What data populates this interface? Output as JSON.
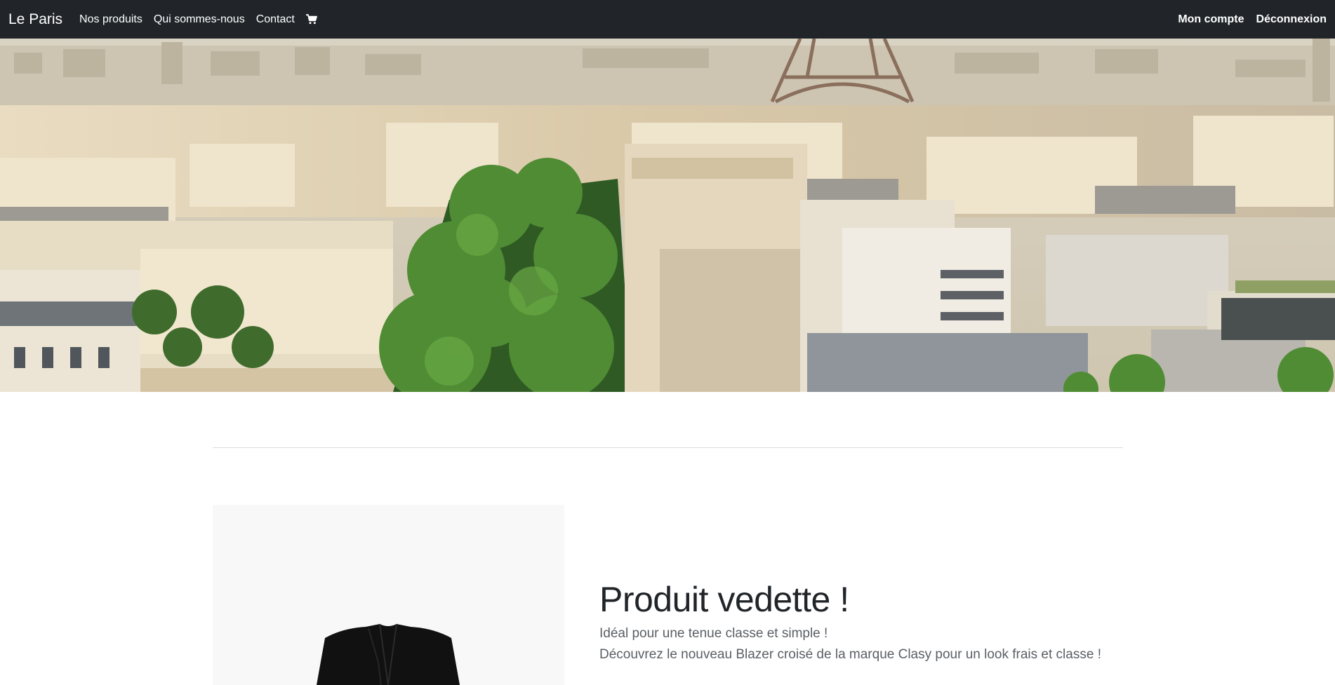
{
  "navbar": {
    "brand": "Le Paris",
    "links": [
      "Nos produits",
      "Qui sommes-nous",
      "Contact"
    ],
    "cart_icon": "cart-icon",
    "right_links": [
      "Mon compte",
      "Déconnexion"
    ]
  },
  "hero": {
    "image": "paris-cityscape-eiffel-tower"
  },
  "featured": {
    "title": "Produit vedette !",
    "line1": "Idéal pour une tenue classe et simple !",
    "line2": "Découvrez le nouveau Blazer croisé de la marque Clasy pour un look frais et classe !",
    "image": "black-blazer"
  },
  "colors": {
    "navbar_bg": "#212529",
    "nav_text": "#ffffff",
    "body_text": "#212529",
    "muted_text": "#5a5f64",
    "product_bg": "#f8f8f8"
  }
}
